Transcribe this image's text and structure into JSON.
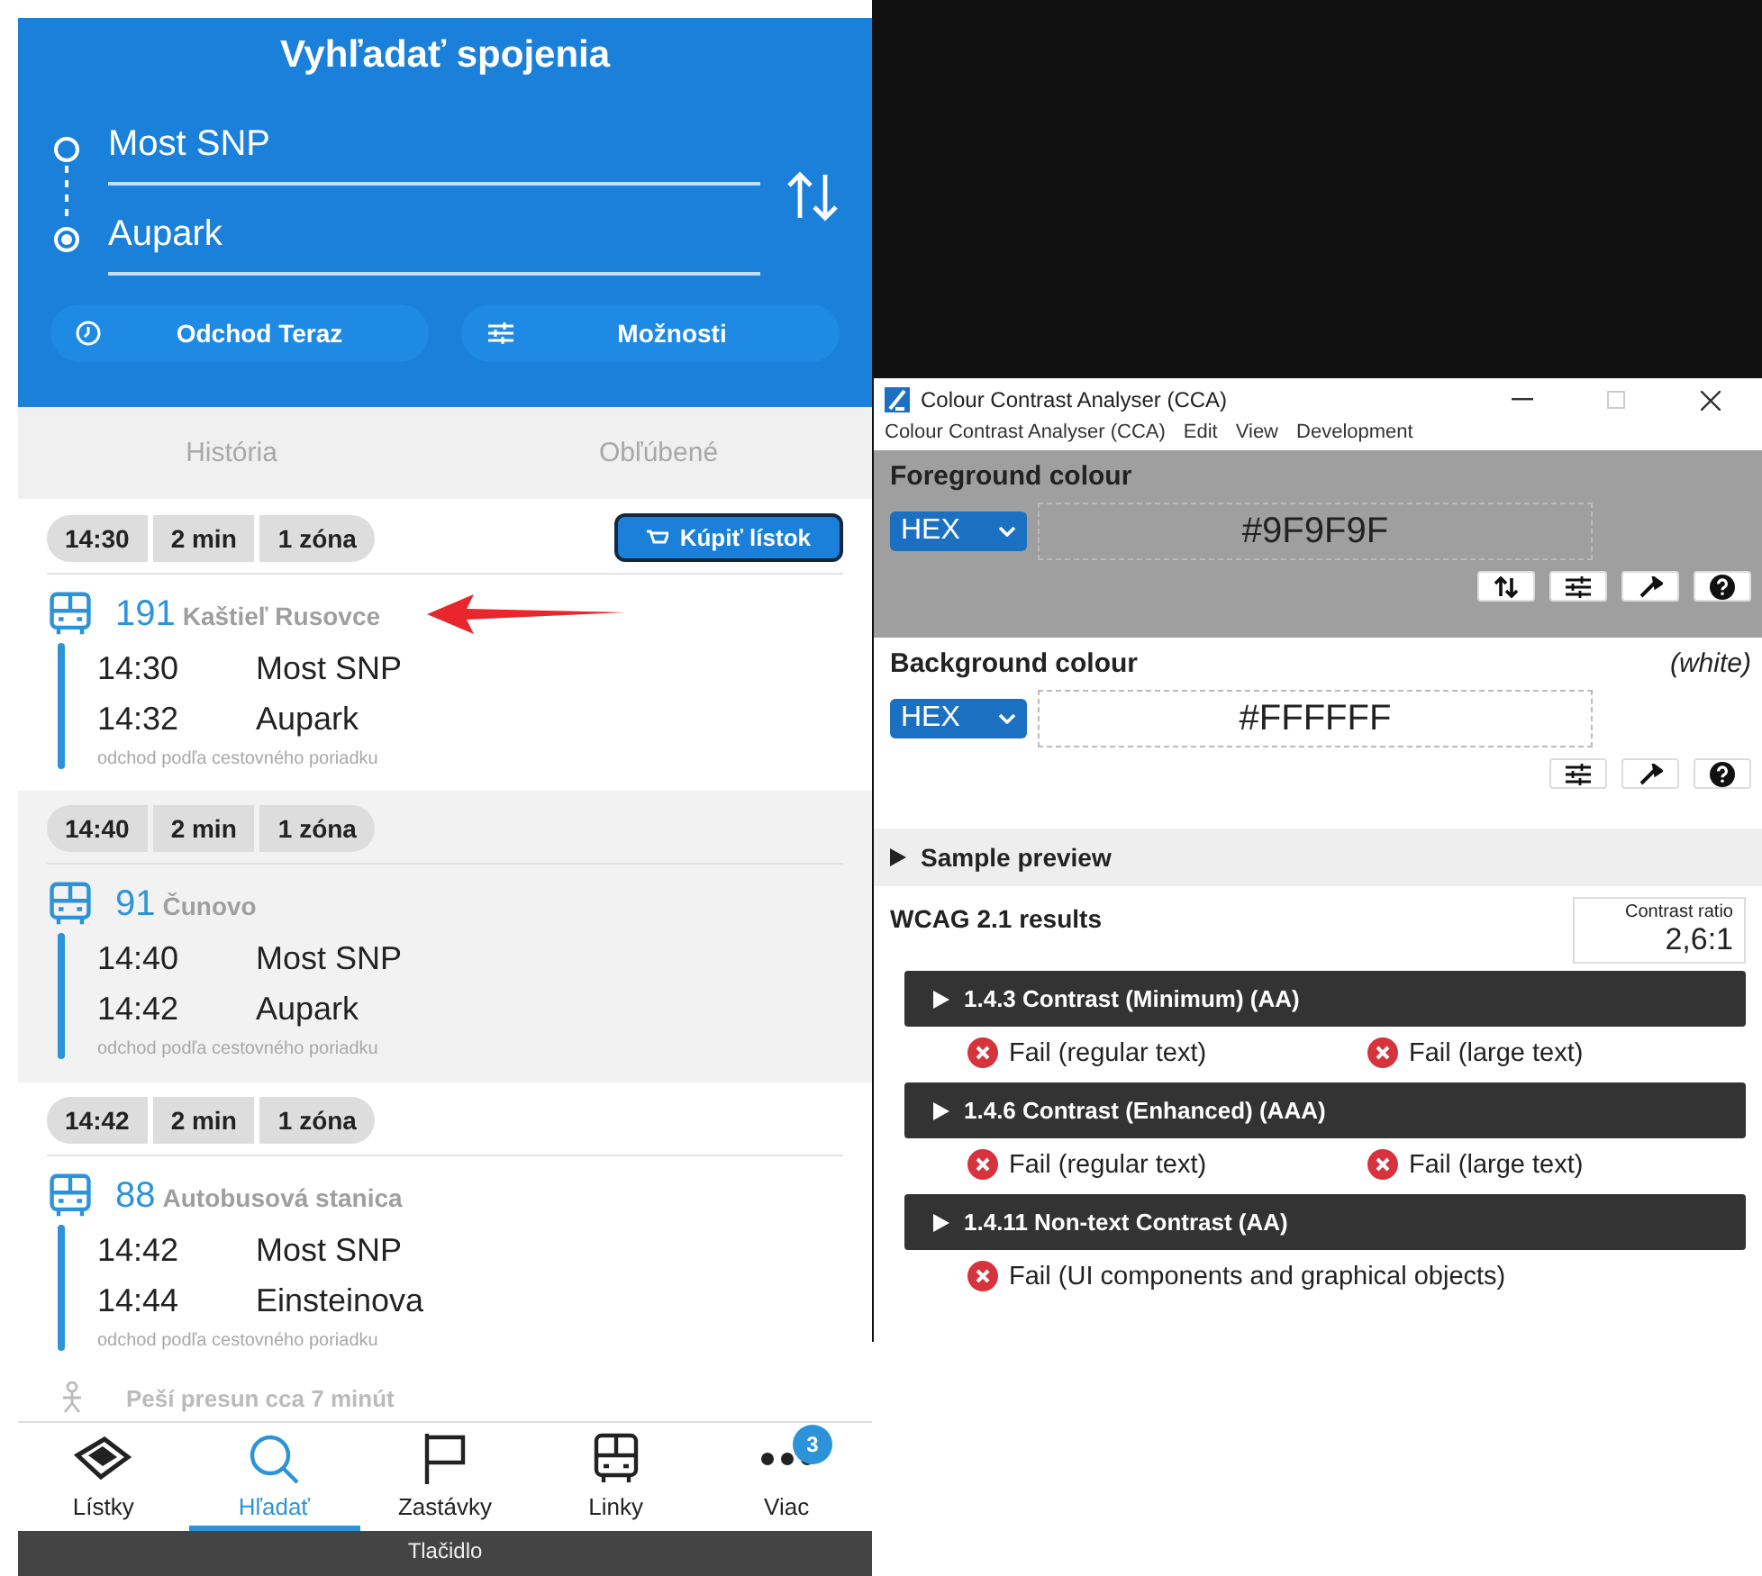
{
  "app": {
    "title": "Vyhľadať spojenia",
    "from": "Most SNP",
    "to": "Aupark",
    "options": [
      {
        "kind": "time",
        "label": "Odchod Teraz"
      },
      {
        "kind": "settings",
        "label": "Možnosti"
      }
    ],
    "tabs": [
      "História",
      "Obľúbené"
    ],
    "journeys": [
      {
        "time": "14:30",
        "duration": "2 min",
        "zones": "1 zóna",
        "buy_button": "Kúpiť lístok",
        "line": "191",
        "destination": "Kaštieľ Rusovce",
        "annotated": true,
        "stops": [
          {
            "time": "14:30",
            "name": "Most SNP"
          },
          {
            "time": "14:32",
            "name": "Aupark"
          }
        ],
        "note": "odchod podľa cestovného poriadku"
      },
      {
        "time": "14:40",
        "duration": "2 min",
        "zones": "1 zóna",
        "line": "91",
        "destination": "Čunovo",
        "annotated": false,
        "stops": [
          {
            "time": "14:40",
            "name": "Most SNP"
          },
          {
            "time": "14:42",
            "name": "Aupark"
          }
        ],
        "note": "odchod podľa cestovného poriadku"
      },
      {
        "time": "14:42",
        "duration": "2 min",
        "zones": "1 zóna",
        "line": "88",
        "destination": "Autobusová stanica",
        "annotated": false,
        "stops": [
          {
            "time": "14:42",
            "name": "Most SNP"
          },
          {
            "time": "14:44",
            "name": "Einsteinova"
          }
        ],
        "note": "odchod podľa cestovného poriadku"
      }
    ],
    "walk": "Peší presun cca 7 minút",
    "nav": [
      {
        "kind": "tickets",
        "label": "Lístky",
        "selected": false
      },
      {
        "kind": "search",
        "label": "Hľadať",
        "selected": true
      },
      {
        "kind": "stops",
        "label": "Zastávky",
        "selected": false
      },
      {
        "kind": "lines",
        "label": "Linky",
        "selected": false
      },
      {
        "kind": "more",
        "label": "Viac",
        "selected": false,
        "badge": "3"
      }
    ],
    "bottom_bar": "Tlačidlo"
  },
  "cca": {
    "title": "Colour Contrast Analyser (CCA)",
    "menu": [
      "Colour Contrast Analyser (CCA)",
      "Edit",
      "View",
      "Development"
    ],
    "foreground": {
      "label": "Foreground colour",
      "format": "HEX",
      "value": "#9F9F9F",
      "color": "#9f9f9f"
    },
    "background": {
      "label": "Background colour",
      "name": "(white)",
      "format": "HEX",
      "value": "#FFFFFF",
      "color": "#ffffff"
    },
    "sample_preview": "Sample preview",
    "results_title": "WCAG 2.1 results",
    "ratio_label": "Contrast ratio",
    "ratio": "2,6:1",
    "criteria": [
      {
        "title": "1.4.3 Contrast (Minimum) (AA)",
        "results": [
          {
            "text": "Fail (regular text)",
            "passed": false
          },
          {
            "text": "Fail (large text)",
            "passed": false
          }
        ]
      },
      {
        "title": "1.4.6 Contrast (Enhanced) (AAA)",
        "results": [
          {
            "text": "Fail (regular text)",
            "passed": false
          },
          {
            "text": "Fail (large text)",
            "passed": false
          }
        ]
      },
      {
        "title": "1.4.11 Non-text Contrast (AA)",
        "results": [
          {
            "text": "Fail (UI components and graphical objects)",
            "passed": false
          }
        ]
      }
    ]
  }
}
